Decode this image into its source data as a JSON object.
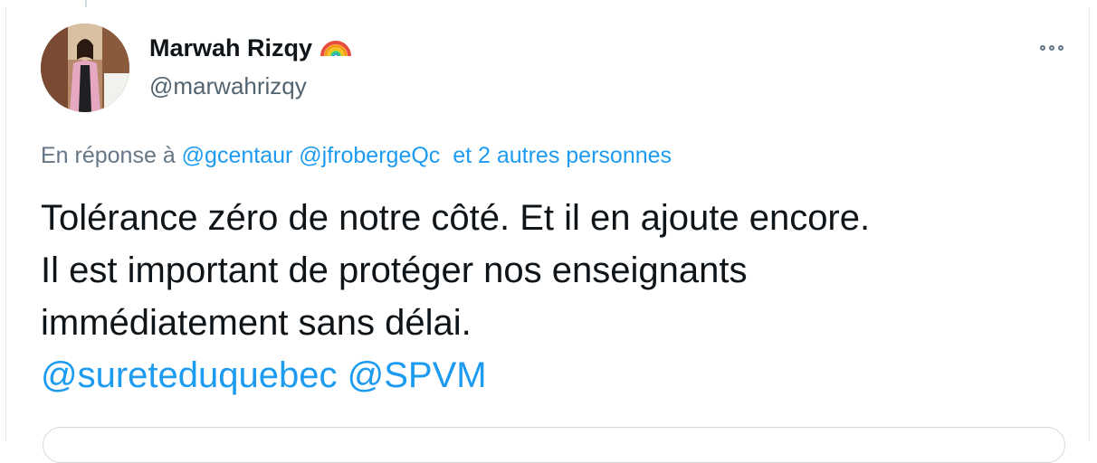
{
  "author": {
    "name": "Marwah Rizqy",
    "emoji": "🌈",
    "handle": "@marwahrizqy"
  },
  "reply": {
    "prefix": "En réponse à",
    "mentions": [
      "@gcentaur",
      "@jfrobergeQc"
    ],
    "others": "et 2 autres personnes"
  },
  "tweet": {
    "lines": [
      "Tolérance zéro de notre côté. Et il en ajoute encore.",
      "Il est important de protéger nos enseignants",
      "immédiatement sans délai."
    ],
    "mentions": [
      "@sureteduquebec",
      "@SPVM"
    ]
  },
  "icons": {
    "more": "more-horizontal-icon",
    "avatar": "profile-photo"
  },
  "colors": {
    "text": "#0f1419",
    "secondary": "#536471",
    "link": "#1d9bf0",
    "border": "#e6ecf0"
  }
}
